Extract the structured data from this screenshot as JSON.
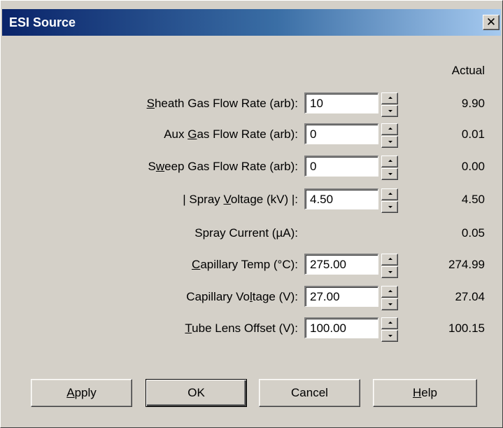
{
  "window": {
    "title": "ESI Source",
    "close_glyph": "✕"
  },
  "header": {
    "actual": "Actual"
  },
  "rows": [
    {
      "label_pre": "",
      "label_u": "S",
      "label_post": "heath Gas Flow Rate (arb):",
      "value": "10",
      "actual": "9.90",
      "editable": true
    },
    {
      "label_pre": "Aux ",
      "label_u": "G",
      "label_post": "as Flow Rate (arb):",
      "value": "0",
      "actual": "0.01",
      "editable": true
    },
    {
      "label_pre": "S",
      "label_u": "w",
      "label_post": "eep Gas Flow Rate (arb):",
      "value": "0",
      "actual": "0.00",
      "editable": true
    },
    {
      "label_pre": "| Spray ",
      "label_u": "V",
      "label_post": "oltage (kV) |:",
      "value": "4.50",
      "actual": "4.50",
      "editable": true
    },
    {
      "label_pre": "Spray Current (µA):",
      "label_u": "",
      "label_post": "",
      "value": "",
      "actual": "0.05",
      "editable": false
    },
    {
      "label_pre": "",
      "label_u": "C",
      "label_post": "apillary Temp (°C):",
      "value": "275.00",
      "actual": "274.99",
      "editable": true
    },
    {
      "label_pre": "Capillary Vo",
      "label_u": "l",
      "label_post": "tage (V):",
      "value": "27.00",
      "actual": "27.04",
      "editable": true
    },
    {
      "label_pre": "",
      "label_u": "T",
      "label_post": "ube Lens Offset (V):",
      "value": "100.00",
      "actual": "100.15",
      "editable": true
    }
  ],
  "buttons": {
    "apply": {
      "u": "A",
      "rest": "pply"
    },
    "ok": {
      "label": "OK"
    },
    "cancel": {
      "label": "Cancel"
    },
    "help": {
      "u": "H",
      "rest": "elp"
    }
  },
  "colors": {
    "dialog_bg": "#d4d0c8",
    "title_start": "#0a246a",
    "title_end": "#a6caf0"
  }
}
